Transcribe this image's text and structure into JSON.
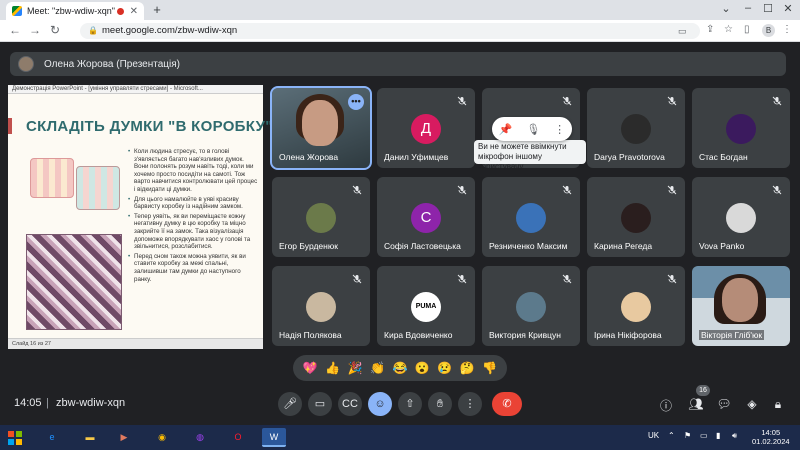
{
  "browser": {
    "tab_title": "Meet: \"zbw-wdiw-xqn\"",
    "url": "meet.google.com/zbw-wdiw-xqn",
    "profile_initial": "B"
  },
  "presenter_bar": {
    "text": "Олена Жорова (Презентація)"
  },
  "presentation": {
    "window_title": "Демонстрація PowerPoint - [уміння управляти стресами] - Microsoft...",
    "slide_title": "СКЛАДІТЬ ДУМКИ \"В КОРОБКУ\"",
    "bullets": [
      "Коли людина стресує, то в голові з'являється багато нав'язливих думок. Вони полонять розум навіть тоді, коли ми хочемо просто посидіти на самоті. Тож варто навчитися контролювати цей процес і відкидати ці думки.",
      "Для цього намалюйте в уяві красиву барвисту коробку із надійним замком.",
      "Тепер уявіть, як ви переміщаєте кожну негативну думку в цю коробку та міцно закрийте її на замок. Така візуалізація допоможе впорядкувати хаос у голові та звільнитися, розслабитися.",
      "Перед сном також можна уявити, як ви ставите коробку за межі спальні, залишивши там думки до наступного ранку."
    ],
    "footer": "Слайд 16 из 27"
  },
  "participants": [
    {
      "name": "Олена Жорова",
      "type": "video",
      "initial": "",
      "color": ""
    },
    {
      "name": "Данил Уфимцев",
      "type": "letter",
      "initial": "Д",
      "color": "#d81b60"
    },
    {
      "name": "",
      "type": "blank",
      "initial": "",
      "color": ""
    },
    {
      "name": "Darya Pravotorova",
      "type": "photo",
      "initial": "",
      "color": "#2b2b2b"
    },
    {
      "name": "Стас Богдан",
      "type": "photo",
      "initial": "",
      "color": "#3b1a5e"
    },
    {
      "name": "Егор Бурденюк",
      "type": "photo",
      "initial": "",
      "color": "#6b7a4a"
    },
    {
      "name": "Софія Ластовецька",
      "type": "letter",
      "initial": "С",
      "color": "#8e24aa"
    },
    {
      "name": "Резниченко Максим",
      "type": "photo",
      "initial": "",
      "color": "#3a72b8"
    },
    {
      "name": "Карина Регеда",
      "type": "photo",
      "initial": "",
      "color": "#2a1e1e"
    },
    {
      "name": "Vova Panko",
      "type": "photo",
      "initial": "",
      "color": "#d9d9d9"
    },
    {
      "name": "Надія Полякова",
      "type": "photo",
      "initial": "",
      "color": "#c9b8a0"
    },
    {
      "name": "Кира Вдовиченко",
      "type": "photo",
      "initial": "PUMA",
      "color": "#ffffff"
    },
    {
      "name": "Виктория Кривцун",
      "type": "photo",
      "initial": "",
      "color": "#5c7a8c"
    },
    {
      "name": "Ірина Нікіфорова",
      "type": "photo",
      "initial": "",
      "color": "#e8c9a0"
    },
    {
      "name": "Вікторія Гліб'юк",
      "type": "video2",
      "initial": "",
      "color": ""
    }
  ],
  "tooltip": "Ви не можете ввімкнути мікрофон іншому користувачу",
  "reactions": [
    "💖",
    "👍",
    "🎉",
    "👏",
    "😂",
    "😮",
    "😢",
    "🤔",
    "👎"
  ],
  "bottom_bar": {
    "time": "14:05",
    "separator": "|",
    "meeting_code": "zbw-wdiw-xqn",
    "participants_count": "16"
  },
  "taskbar": {
    "lang": "UK",
    "time": "14:05",
    "date": "01.02.2024"
  },
  "colors": {
    "accent": "#8ab4f8",
    "end_call": "#ea4335",
    "tile_bg": "#3c4043",
    "background": "#202124"
  }
}
